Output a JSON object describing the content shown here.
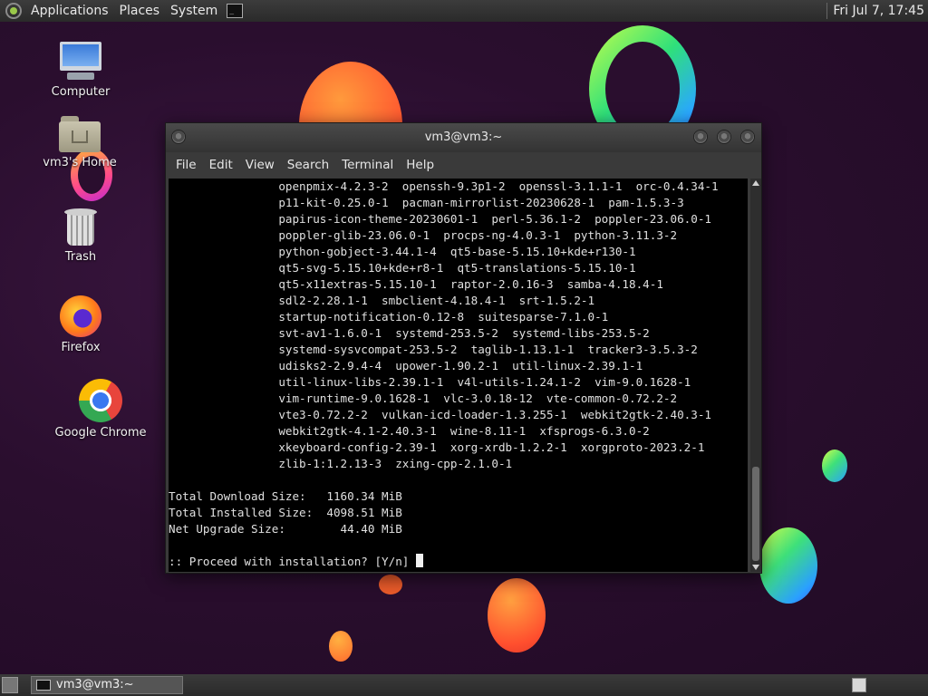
{
  "top_panel": {
    "menus": [
      "Applications",
      "Places",
      "System"
    ],
    "clock": "Fri Jul  7, 17:45"
  },
  "desktop": {
    "icons": [
      {
        "label": "Computer",
        "icon": "computer-icon"
      },
      {
        "label": "vm3's Home",
        "icon": "home-folder-icon"
      },
      {
        "label": "Trash",
        "icon": "trash-icon"
      },
      {
        "label": "Firefox",
        "icon": "firefox-icon"
      },
      {
        "label": "Google Chrome",
        "icon": "chrome-icon"
      }
    ]
  },
  "terminal": {
    "title": "vm3@vm3:~",
    "menu": [
      "File",
      "Edit",
      "View",
      "Search",
      "Terminal",
      "Help"
    ],
    "lines": [
      "                openpmix-4.2.3-2  openssh-9.3p1-2  openssl-3.1.1-1  orc-0.4.34-1",
      "                p11-kit-0.25.0-1  pacman-mirrorlist-20230628-1  pam-1.5.3-3",
      "                papirus-icon-theme-20230601-1  perl-5.36.1-2  poppler-23.06.0-1",
      "                poppler-glib-23.06.0-1  procps-ng-4.0.3-1  python-3.11.3-2",
      "                python-gobject-3.44.1-4  qt5-base-5.15.10+kde+r130-1",
      "                qt5-svg-5.15.10+kde+r8-1  qt5-translations-5.15.10-1",
      "                qt5-x11extras-5.15.10-1  raptor-2.0.16-3  samba-4.18.4-1",
      "                sdl2-2.28.1-1  smbclient-4.18.4-1  srt-1.5.2-1",
      "                startup-notification-0.12-8  suitesparse-7.1.0-1",
      "                svt-av1-1.6.0-1  systemd-253.5-2  systemd-libs-253.5-2",
      "                systemd-sysvcompat-253.5-2  taglib-1.13.1-1  tracker3-3.5.3-2",
      "                udisks2-2.9.4-4  upower-1.90.2-1  util-linux-2.39.1-1",
      "                util-linux-libs-2.39.1-1  v4l-utils-1.24.1-2  vim-9.0.1628-1",
      "                vim-runtime-9.0.1628-1  vlc-3.0.18-12  vte-common-0.72.2-2",
      "                vte3-0.72.2-2  vulkan-icd-loader-1.3.255-1  webkit2gtk-2.40.3-1",
      "                webkit2gtk-4.1-2.40.3-1  wine-8.11-1  xfsprogs-6.3.0-2",
      "                xkeyboard-config-2.39-1  xorg-xrdb-1.2.2-1  xorgproto-2023.2-1",
      "                zlib-1:1.2.13-3  zxing-cpp-2.1.0-1",
      "",
      "Total Download Size:   1160.34 MiB",
      "Total Installed Size:  4098.51 MiB",
      "Net Upgrade Size:        44.40 MiB",
      "",
      ":: Proceed with installation? [Y/n] "
    ]
  },
  "bottom_panel": {
    "task_label": "vm3@vm3:~"
  }
}
